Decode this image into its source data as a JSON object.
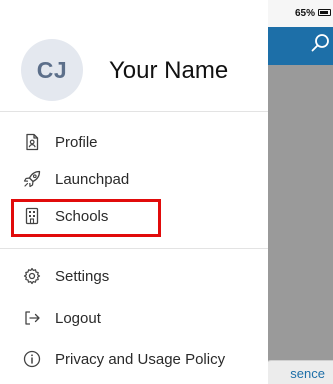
{
  "status_bar": {
    "battery_percent": "65%"
  },
  "background": {
    "bottom_tab_label": "sence"
  },
  "drawer": {
    "user": {
      "initials": "CJ",
      "name": "Your Name"
    },
    "menu": {
      "profile": {
        "label": "Profile",
        "icon": "profile-document-icon"
      },
      "launchpad": {
        "label": "Launchpad",
        "icon": "rocket-icon"
      },
      "schools": {
        "label": "Schools",
        "icon": "school-building-icon"
      },
      "settings": {
        "label": "Settings",
        "icon": "gear-icon"
      },
      "logout": {
        "label": "Logout",
        "icon": "logout-icon"
      },
      "privacy": {
        "label": "Privacy and Usage Policy",
        "icon": "info-icon"
      }
    },
    "highlight_color": "#e10b0b"
  },
  "colors": {
    "header_blue": "#1d6fa8",
    "avatar_bg": "#e4e8ef",
    "avatar_text": "#5c6f8a"
  }
}
